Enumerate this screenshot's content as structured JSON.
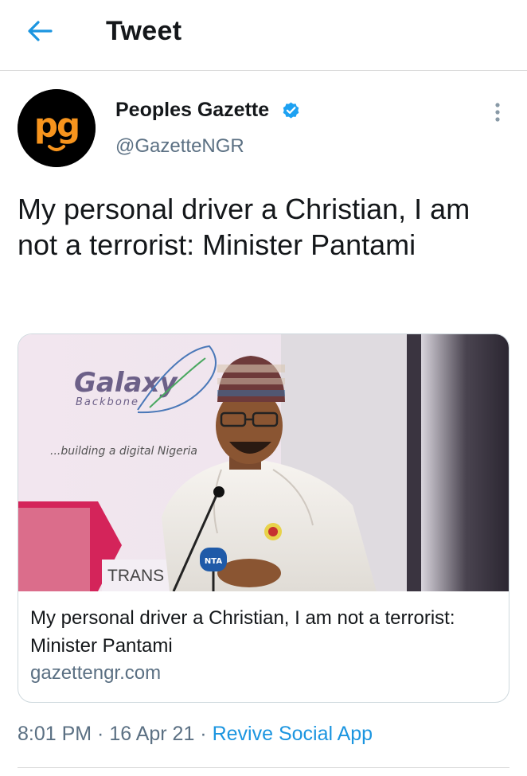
{
  "header": {
    "title": "Tweet",
    "back_icon": "arrow-left-icon"
  },
  "author": {
    "name": "Peoples Gazette",
    "handle": "@GazetteNGR",
    "verified": true,
    "avatar_logo_text": "pg",
    "avatar_colors": {
      "background": "#000000",
      "logo": "#f7941d"
    }
  },
  "tweet": {
    "text": "My personal driver a Christian, I am not a terrorist: Minister Pantami"
  },
  "card": {
    "image_text": {
      "brand_main": "Galaxy",
      "brand_sub": "Backbone",
      "tagline": "...building a digital Nigeria",
      "banner_fragment": "TRANS",
      "mic_label": "NTA"
    },
    "title": "My personal driver a Christian, I am not a terrorist: Minister Pantami",
    "domain": "gazettengr.com"
  },
  "meta": {
    "time": "8:01 PM",
    "separator": " · ",
    "date": "16 Apr 21",
    "app": "Revive Social App"
  },
  "colors": {
    "accent": "#1b95e0",
    "secondary_text": "#5b7083",
    "primary_text": "#14171a",
    "verified": "#1da1f2"
  }
}
